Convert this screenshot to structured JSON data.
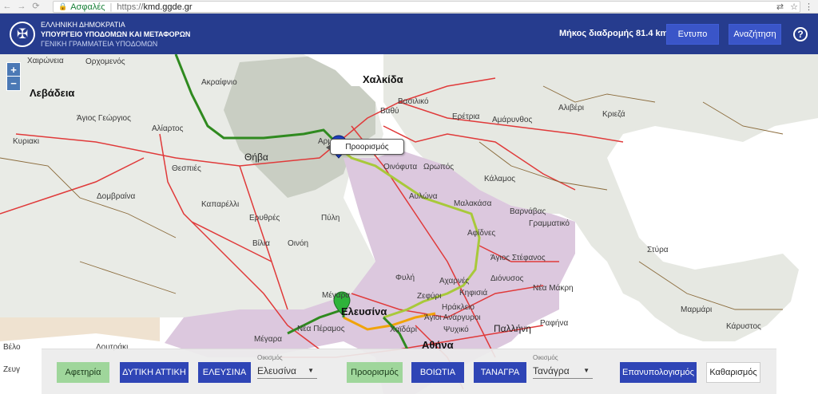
{
  "browser": {
    "secure_label": "Ασφαλές",
    "url_scheme": "https://",
    "url_host": "kmd.ggde.gr"
  },
  "header": {
    "org_line1": "ΕΛΛΗΝΙΚΗ ΔΗΜΟΚΡΑΤΙΑ",
    "org_line2": "ΥΠΟΥΡΓΕΙΟ ΥΠΟΔΟΜΩΝ ΚΑΙ ΜΕΤΑΦΟΡΩΝ",
    "org_line3": "ΓΕΝΙΚΗ ΓΡΑΜΜΑΤΕΙΑ ΥΠΟΔΟΜΩΝ",
    "route_length": "Μήκος διαδρομής 81.4 km",
    "print_label": "Εντυπο",
    "search_label": "Αναζήτηση",
    "help_label": "?"
  },
  "map": {
    "zoom_in": "+",
    "zoom_out": "−",
    "tooltip": "Προορισμός",
    "labels": {
      "chalkida": "Χαλκίδα",
      "livadeia": "Λεβάδεια",
      "athina": "Αθήνα",
      "elefsina": "Ελευσίνα",
      "pallini": "Παλλήνη",
      "chaironeia": "Χαιρώνεια",
      "orchomenos": "Ορχομενός",
      "akraifnio": "Ακραίφνιο",
      "vathy": "Βαθύ",
      "vasiliko": "Βασιλικό",
      "aliveri": "Αλιβέρι",
      "kriezia": "Κριεζά",
      "eretria": "Ερέτρια",
      "amarynthos": "Αμάρυνθος",
      "agios_georgios": "Άγιος Γεώργιος",
      "aliartos": "Αλίαρτος",
      "kyriaki": "Κυριακι",
      "thiva": "Θήβα",
      "thespies": "Θεσπιές",
      "oinofyta": "Οινόφυτα",
      "oropos": "Ωρωπός",
      "kalamos": "Κάλαμος",
      "dompraina": "Δομβραίνα",
      "avlona": "Αυλώνα",
      "kaparelli": "Καπαρέλλι",
      "erythres": "Ερυθρές",
      "pyli": "Πύλη",
      "malakasa": "Μαλακάσα",
      "varnavas": "Βαρνάβας",
      "grammatiko": "Γραμματικό",
      "afidnes": "Αφίδνες",
      "vilia": "Βίλια",
      "oinoi": "Οινόη",
      "agios_stefanos": "Άγιος Στέφανος",
      "styra": "Στύρα",
      "dionysos": "Διόνυσος",
      "fyli": "Φυλή",
      "acharnes": "Αχαρνές",
      "nea_makri": "Νέα Μάκρη",
      "megara": "Μέγαρα",
      "zefyri": "Ζεφύρι",
      "kifisia": "Κηφισιά",
      "irakleio": "Ηράκλειο",
      "agioi_anargyroi": "Άγιοι Ανάργυροι",
      "marmari": "Μαρμάρι",
      "rafina": "Ραφήνα",
      "nea_peramos": "Νέα Πέραμος",
      "chaidari": "Χαϊδάρι",
      "psychiko": "Ψυχικό",
      "karystos": "Κάρυστος",
      "velo": "Βέλο",
      "loutraki": "Λουτράκι",
      "megara2": "Μέγαρα",
      "zevgolatio": "Ζευγ",
      "arma": "Αρμ"
    }
  },
  "panel": {
    "start_label": "Αφετηρία",
    "region1_label": "ΔΥΤΙΚΗ ΑΤΤΙΚΗ",
    "municipality1_label": "ΕΛΕΥΣΙΝΑ",
    "settlement1_caption": "Οικισμός",
    "settlement1_value": "Ελευσίνα",
    "dest_label": "Προορισμός",
    "region2_label": "ΒΟΙΩΤΙΑ",
    "municipality2_label": "ΤΑΝΑΓΡΑ",
    "settlement2_caption": "Οικισμός",
    "settlement2_value": "Τανάγρα",
    "recalc_label": "Επανυπολογισμός",
    "clear_label": "Καθαρισμός"
  },
  "colors": {
    "header_bg": "#263c8e",
    "button_blue": "#2f45b6",
    "button_green": "#9fd69b",
    "region_purple": "#ddc9df",
    "route_green": "#2f8a1f",
    "route_yellow": "#a8c93a",
    "road_red": "#e03a3a",
    "sea": "#ffffff"
  }
}
